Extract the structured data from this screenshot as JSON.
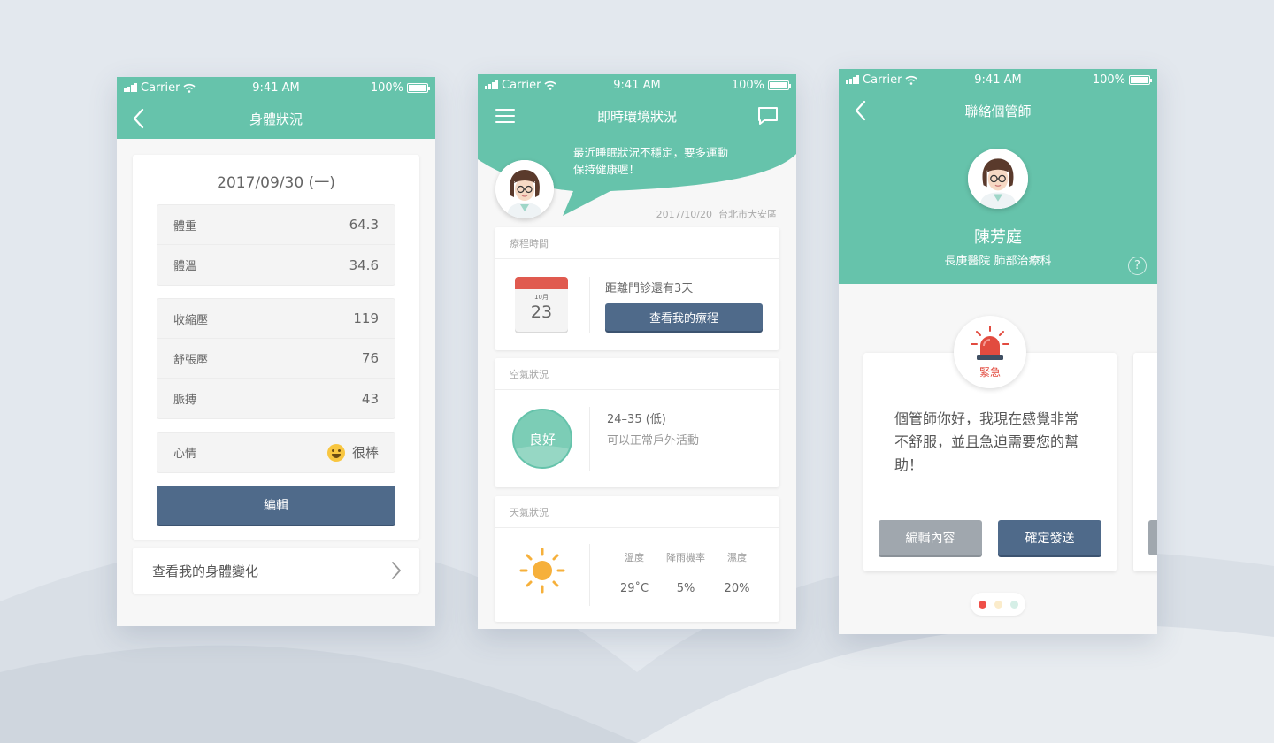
{
  "colors": {
    "teal": "#66c3ab",
    "button_blue": "#4f6a8a",
    "button_gray": "#a0a7ae",
    "alert_red": "#e24b3f"
  },
  "status_bar": {
    "carrier": "Carrier",
    "time": "9:41 AM",
    "battery": "100%"
  },
  "screen1": {
    "title": "身體狀況",
    "date": "2017/09/30 (一)",
    "group1": [
      {
        "label": "體重",
        "value": "64.3"
      },
      {
        "label": "體溫",
        "value": "34.6"
      }
    ],
    "group2": [
      {
        "label": "收縮壓",
        "value": "119"
      },
      {
        "label": "舒張壓",
        "value": "76"
      },
      {
        "label": "脈搏",
        "value": "43"
      }
    ],
    "mood": {
      "label": "心情",
      "value": "很棒",
      "icon": "laughing-emoji-icon"
    },
    "edit_button": "編輯",
    "view_changes": "查看我的身體變化"
  },
  "screen2": {
    "title": "即時環境狀況",
    "bubble_line1": "最近睡眠狀況不穩定，要多運動",
    "bubble_line2": "保持健康喔！",
    "date": "2017/10/20",
    "location": "台北市大安區",
    "treatment": {
      "title": "療程時間",
      "cal_month": "10月",
      "cal_day": "23",
      "countdown": "距離門診還有3天",
      "button": "查看我的療程"
    },
    "air": {
      "title": "空氣狀況",
      "badge": "良好",
      "range": "24–35 (低)",
      "advice": "可以正常戶外活動"
    },
    "weather": {
      "title": "天氣狀況",
      "icon": "sun-icon",
      "columns": [
        {
          "header": "溫度",
          "value": "29˚C"
        },
        {
          "header": "降雨機率",
          "value": "5%"
        },
        {
          "header": "濕度",
          "value": "20%"
        }
      ]
    }
  },
  "screen3": {
    "title": "聯絡個管師",
    "name": "陳芳庭",
    "department": "長庚醫院 肺部治療科",
    "help": "?",
    "alert_label": "緊急",
    "message": "個管師你好，我現在感覺非常不舒服，並且急迫需要您的幫助！",
    "edit_button": "編輯內容",
    "send_button": "確定發送",
    "page_dots": [
      "#ef4f48",
      "#fbeccb",
      "#d6efe7"
    ]
  }
}
